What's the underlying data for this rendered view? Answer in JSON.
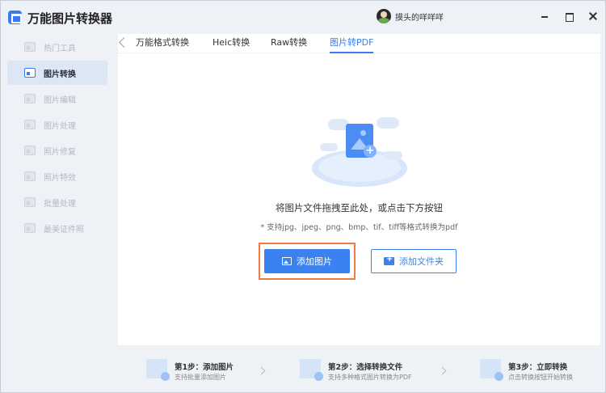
{
  "app": {
    "title": "万能图片转换器"
  },
  "user": {
    "name": "摸头的咩咩咩"
  },
  "sidebar": {
    "items": [
      {
        "label": "热门工具",
        "active": false
      },
      {
        "label": "图片转换",
        "active": true
      },
      {
        "label": "图片编辑",
        "active": false
      },
      {
        "label": "图片处理",
        "active": false
      },
      {
        "label": "照片修复",
        "active": false
      },
      {
        "label": "照片特效",
        "active": false
      },
      {
        "label": "批量处理",
        "active": false
      },
      {
        "label": "最美证件照",
        "active": false
      }
    ]
  },
  "tabs": [
    {
      "label": "万能格式转换",
      "active": false
    },
    {
      "label": "Heic转换",
      "active": false
    },
    {
      "label": "Raw转换",
      "active": false
    },
    {
      "label": "图片转PDF",
      "active": true
    }
  ],
  "main": {
    "drop_text": "将图片文件拖拽至此处，或点击下方按钮",
    "support_text": "* 支持jpg、jpeg、png、bmp、tif、tiff等格式转换为pdf",
    "add_image_label": "添加图片",
    "add_folder_label": "添加文件夹"
  },
  "steps": [
    {
      "title": "第1步：添加图片",
      "subtitle": "支持批量添加图片"
    },
    {
      "title": "第2步：选择转换文件",
      "subtitle": "支持多种格式图片转换为PDF"
    },
    {
      "title": "第3步：立即转换",
      "subtitle": "点击转换按钮开始转换"
    }
  ],
  "colors": {
    "accent": "#3b82f0",
    "highlight_border": "#f07b3f",
    "sidebar_active_bg": "#dce6f5"
  }
}
